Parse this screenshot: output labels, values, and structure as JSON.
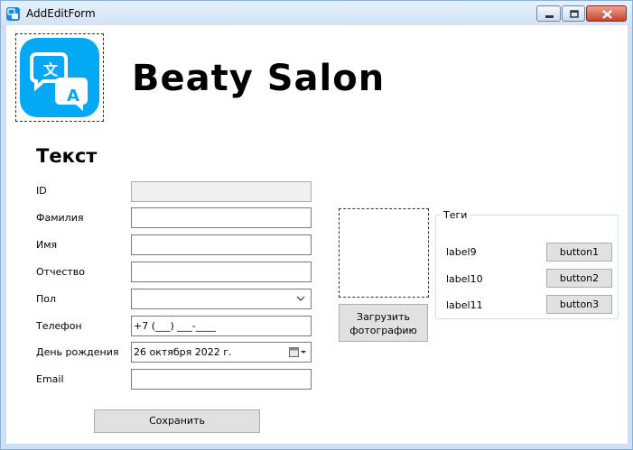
{
  "window": {
    "title": "AddEditForm",
    "icon": "translate-icon"
  },
  "header": {
    "brand": "Beaty Salon",
    "logo": "translate-icon"
  },
  "form": {
    "title": "Текст",
    "fields": [
      {
        "label": "ID",
        "value": ""
      },
      {
        "label": "Фамилия",
        "value": ""
      },
      {
        "label": "Имя",
        "value": ""
      },
      {
        "label": "Отчество",
        "value": ""
      },
      {
        "label": "Пол",
        "value": ""
      },
      {
        "label": "Телефон",
        "value": "+7 (___) ___-____"
      },
      {
        "label": "День рождения",
        "value": "26  октября  2022 г."
      },
      {
        "label": "Email",
        "value": ""
      }
    ],
    "save_label": "Сохранить"
  },
  "photo": {
    "upload_label": "Загрузить фотографию"
  },
  "tags": {
    "legend": "Теги",
    "items": [
      {
        "label": "label9",
        "button": "button1"
      },
      {
        "label": "label10",
        "button": "button2"
      },
      {
        "label": "label11",
        "button": "button3"
      }
    ]
  },
  "colors": {
    "logo_bg": "#03a9f4",
    "titlebar": "#d3e3f5",
    "close_button": "#c7432a"
  }
}
